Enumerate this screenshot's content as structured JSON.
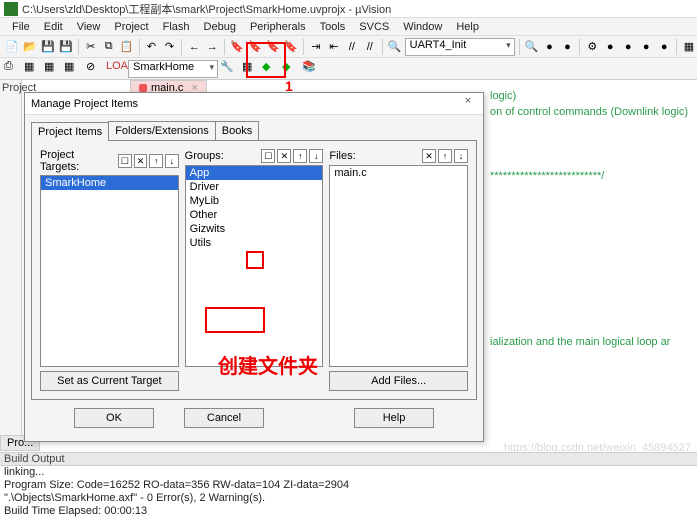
{
  "titlebar": {
    "path": "C:\\Users\\zld\\Desktop\\工程副本\\smark\\Project\\SmarkHome.uvprojx - µVision"
  },
  "menu": {
    "items": [
      "File",
      "Edit",
      "View",
      "Project",
      "Flash",
      "Debug",
      "Peripherals",
      "Tools",
      "SVCS",
      "Window",
      "Help"
    ]
  },
  "toolbar1": {
    "combo": "UART4_Init"
  },
  "toolbar2": {
    "target": "SmarkHome"
  },
  "annotations": {
    "num1": "1",
    "create_folder": "创建文件夹"
  },
  "project_panel": {
    "label": "Project"
  },
  "tab": {
    "file": "main.c"
  },
  "code": {
    "l1": "logic)",
    "l2": "on of control commands (Downlink logic)",
    "l3": "**************************/",
    "l4": "ialization and the main logical loop ar"
  },
  "dialog": {
    "title": "Manage Project Items",
    "tabs": [
      "Project Items",
      "Folders/Extensions",
      "Books"
    ],
    "col_targets": {
      "label": "Project Targets:",
      "items": [
        "SmarkHome"
      ],
      "button": "Set as Current Target"
    },
    "col_groups": {
      "label": "Groups:",
      "items": [
        "App",
        "Driver",
        "MyLib",
        "Other",
        "Gizwits",
        "Utils"
      ]
    },
    "col_files": {
      "label": "Files:",
      "items": [
        "main.c"
      ],
      "button": "Add Files..."
    },
    "buttons": {
      "ok": "OK",
      "cancel": "Cancel",
      "help": "Help"
    }
  },
  "proj_bottom": "Pro...",
  "build": {
    "header": "Build Output",
    "l1": "linking...",
    "l2": "Program Size: Code=16252 RO-data=356 RW-data=104 ZI-data=2904",
    "l3": "\".\\Objects\\SmarkHome.axf\" - 0 Error(s), 2 Warning(s).",
    "l4": "Build Time Elapsed:  00:00:13"
  },
  "watermark": "https://blog.csdn.net/weixin_45894527"
}
